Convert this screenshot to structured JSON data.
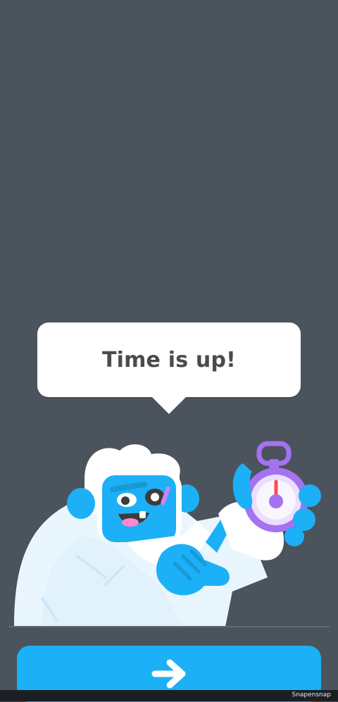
{
  "message": {
    "text": "Time is up!"
  },
  "character": {
    "name": "yeti-with-stopwatch",
    "timer_icon": "stopwatch-icon"
  },
  "footer": {
    "continue_icon": "arrow-right-icon"
  },
  "watermark": {
    "text": "Snapensnap"
  },
  "colors": {
    "background": "#4b535c",
    "bubble": "#ffffff",
    "primary_button": "#1cb0f6",
    "character_blue": "#1cb0f6",
    "stopwatch_purple": "#a572f0"
  }
}
